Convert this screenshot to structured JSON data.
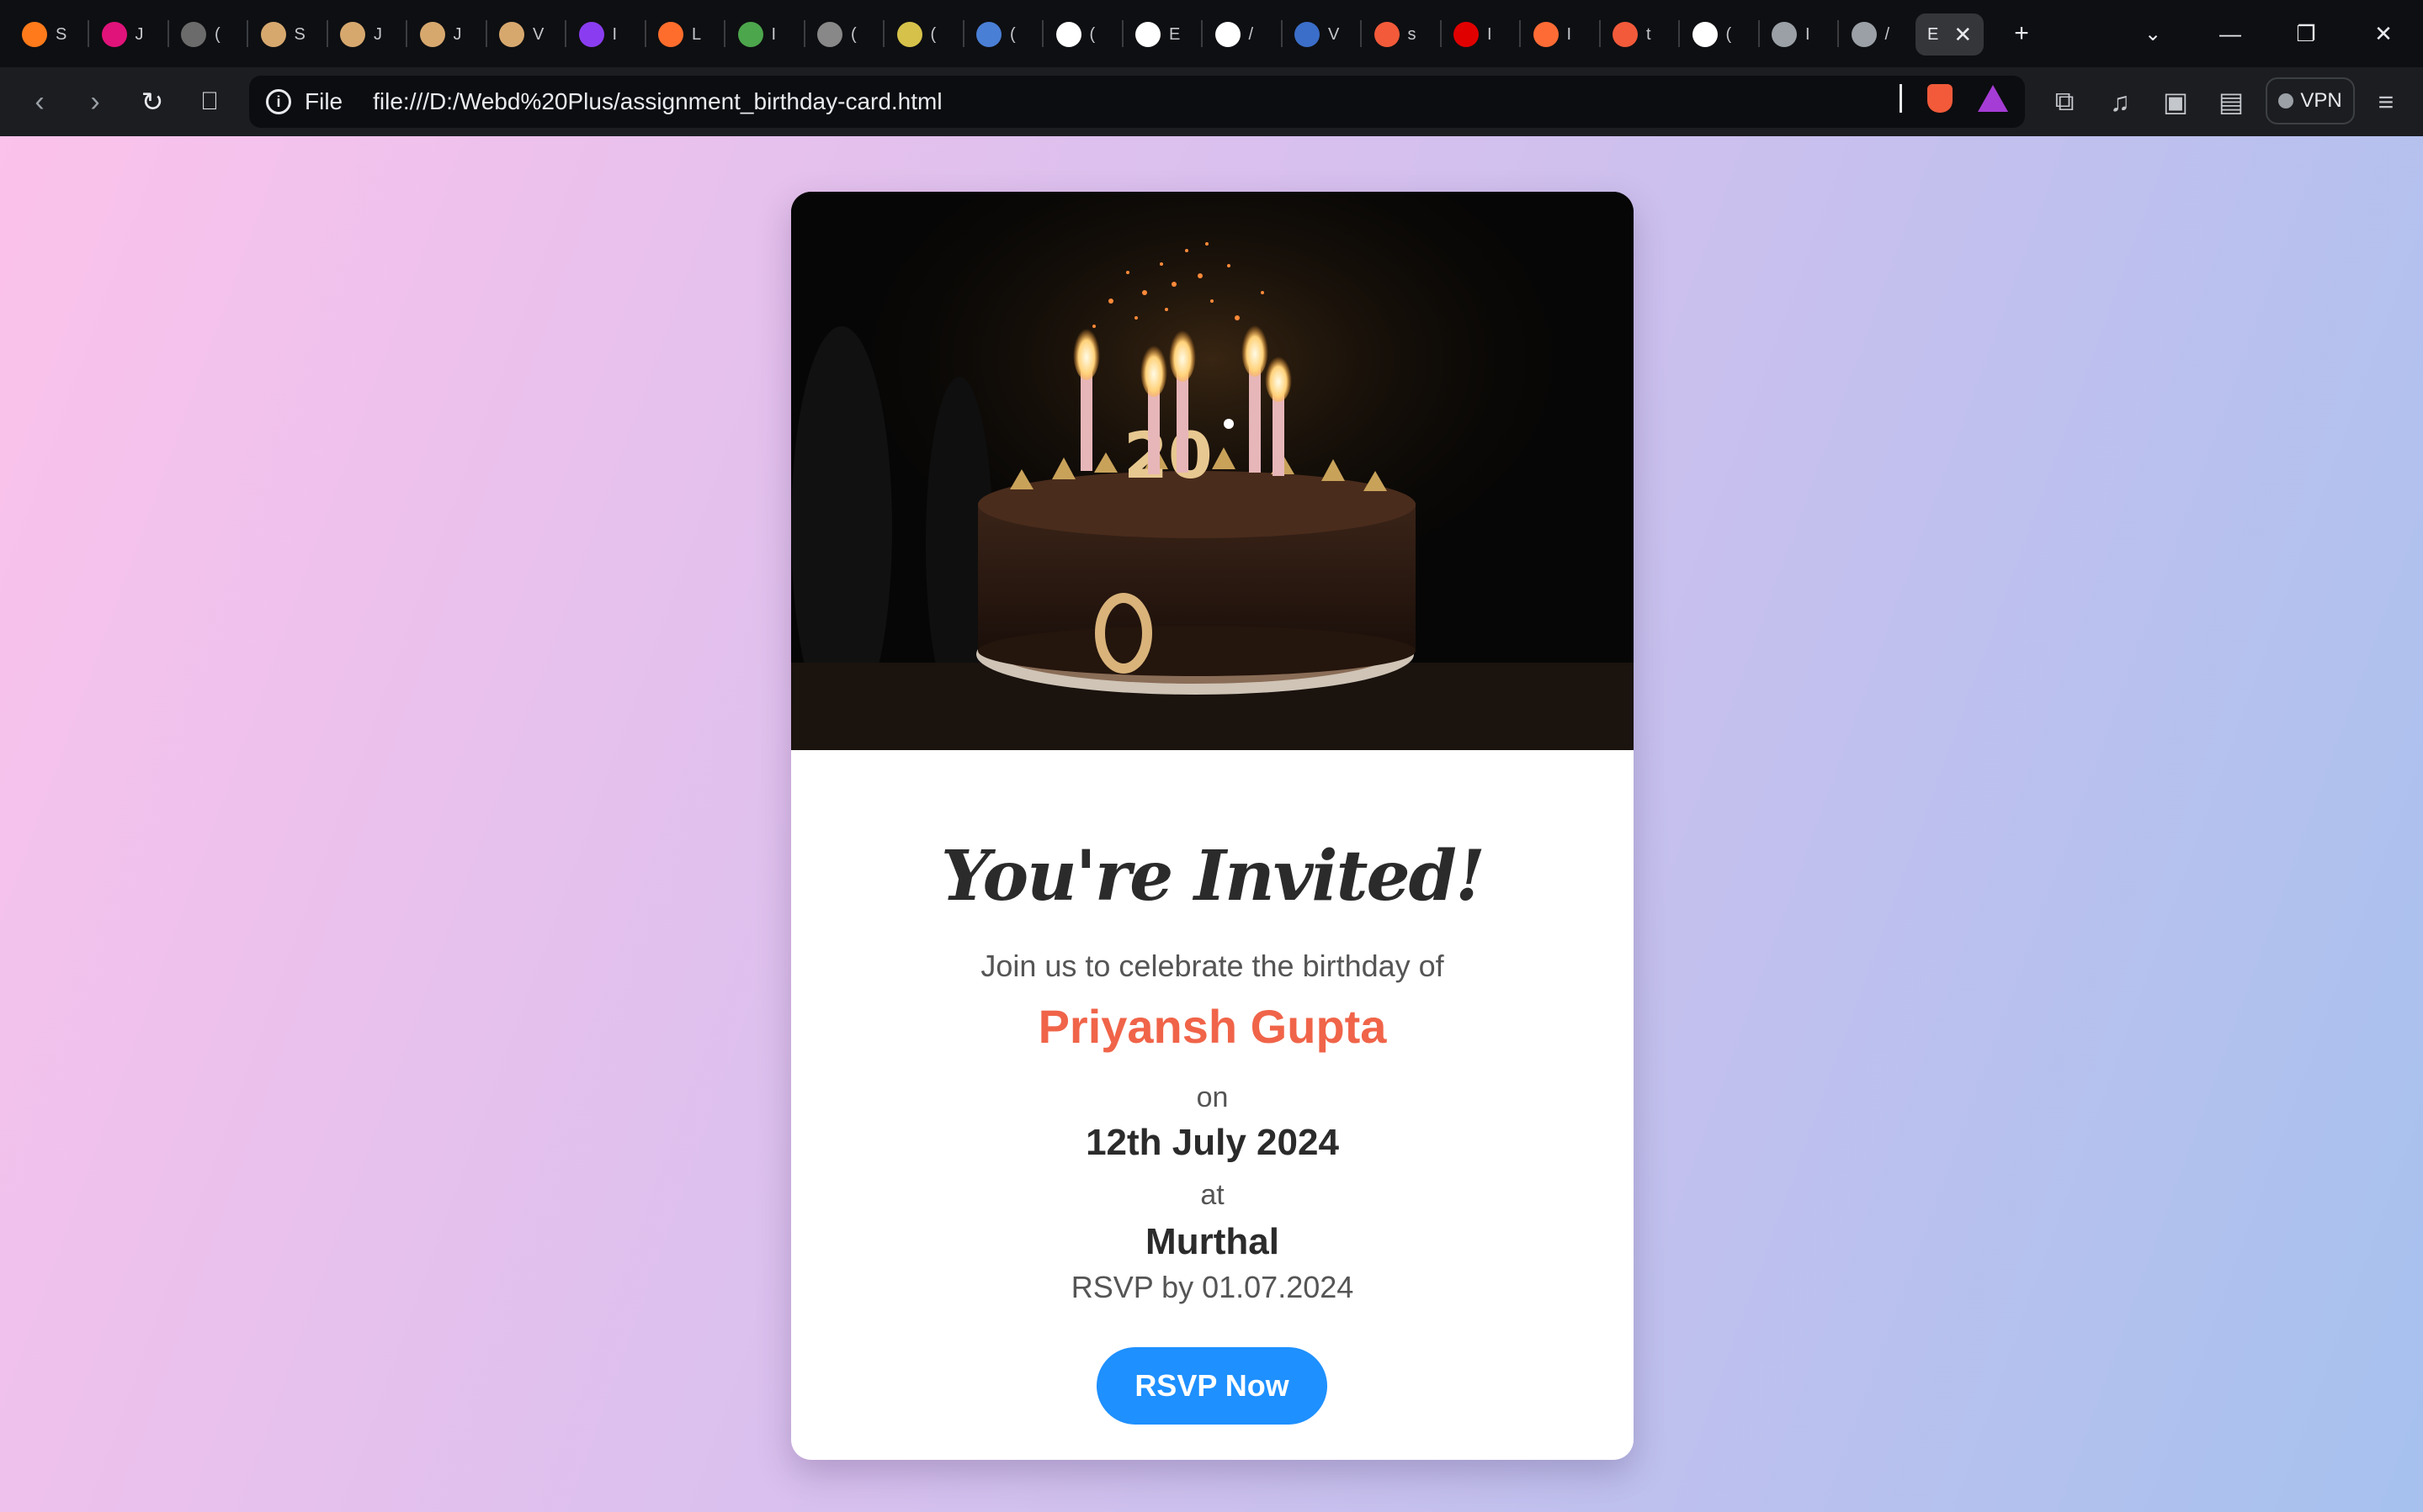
{
  "browser": {
    "tabs": [
      {
        "icon": "fire-icon",
        "letter": "S",
        "color": "#ff7a1a"
      },
      {
        "icon": "gift-icon",
        "letter": "J",
        "color": "#e0137a"
      },
      {
        "icon": "globe-icon",
        "letter": "(",
        "color": "#6b6b6b"
      },
      {
        "icon": "shield-icon",
        "letter": "S",
        "color": "#d7a86e"
      },
      {
        "icon": "shield-icon",
        "letter": "J",
        "color": "#d7a86e"
      },
      {
        "icon": "shield-icon",
        "letter": "J",
        "color": "#d7a86e"
      },
      {
        "icon": "shield-icon",
        "letter": "V",
        "color": "#d7a86e"
      },
      {
        "icon": "flag-icon",
        "letter": "I",
        "color": "#8a3df0"
      },
      {
        "icon": "app-icon",
        "letter": "L",
        "color": "#ff6d2c"
      },
      {
        "icon": "leaf-icon",
        "letter": "I",
        "color": "#4ca64c"
      },
      {
        "icon": "target-icon",
        "letter": "(",
        "color": "#888"
      },
      {
        "icon": "sun-icon",
        "letter": "(",
        "color": "#d6c24a"
      },
      {
        "icon": "circle-icon",
        "letter": "(",
        "color": "#4a7fd6"
      },
      {
        "icon": "amazon-icon",
        "letter": "(",
        "color": "#fff"
      },
      {
        "icon": "amazon-icon",
        "letter": "E",
        "color": "#fff"
      },
      {
        "icon": "amazon-icon",
        "letter": "/",
        "color": "#fff"
      },
      {
        "icon": "orbit-icon",
        "letter": "V",
        "color": "#3b6ec9"
      },
      {
        "icon": "brave-icon",
        "letter": "s",
        "color": "#f25a3a"
      },
      {
        "icon": "hm-icon",
        "letter": "I",
        "color": "#e10000"
      },
      {
        "icon": "go-icon",
        "letter": "I",
        "color": "#ff6b35"
      },
      {
        "icon": "brave-icon",
        "letter": "t",
        "color": "#f25a3a"
      },
      {
        "icon": "openai-icon",
        "letter": "(",
        "color": "#fff"
      },
      {
        "icon": "globe-icon",
        "letter": "I",
        "color": "#9aa0a6"
      },
      {
        "icon": "globe-icon",
        "letter": "/",
        "color": "#9aa0a6"
      }
    ],
    "active_tab": {
      "letter": "E"
    },
    "address": {
      "scheme_label": "File",
      "url": "file:///D:/Webd%20Plus/assignment_birthday-card.html"
    },
    "vpn_label": "VPN"
  },
  "card": {
    "title": "You're Invited!",
    "join_text": "Join us to celebrate the birthday of",
    "name": "Priyansh Gupta",
    "on_text": "on",
    "date": "12th July 2024",
    "at_text": "at",
    "place": "Murthal",
    "rsvp_by": "RSVP by 01.07.2024",
    "rsvp_button": "RSVP Now",
    "image_alt_icon": "birthday-cake-icon",
    "cake_number": "20"
  },
  "colors": {
    "accent_name": "#f06449",
    "button": "#1e90ff",
    "gradient_start": "#fbc2eb",
    "gradient_end": "#a6c1ee"
  }
}
